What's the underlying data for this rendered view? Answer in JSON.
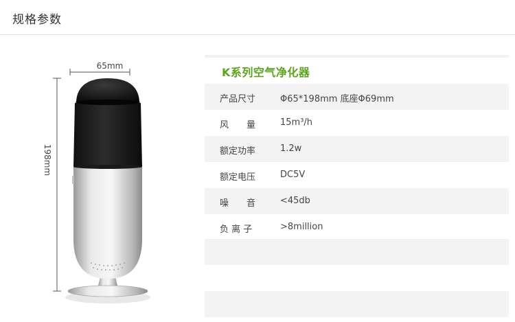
{
  "header": {
    "title": "规格参数"
  },
  "product": {
    "width_label": "65mm",
    "height_label": "198mm"
  },
  "specs": {
    "title": "K系列空气净化器",
    "rows": [
      {
        "label": "产品尺寸",
        "value": "Φ65*198mm  底座Φ69mm"
      },
      {
        "label": "风　　量",
        "value": "15m³/h"
      },
      {
        "label": "额定功率",
        "value": "1.2w"
      },
      {
        "label": "额定电压",
        "value": "DC5V"
      },
      {
        "label": "噪　　音",
        "value": "<45db"
      },
      {
        "label": "负 离 子",
        "value": ">8million"
      }
    ]
  },
  "colors": {
    "accent": "#5aa518",
    "stripe": "#f3f3f3"
  }
}
